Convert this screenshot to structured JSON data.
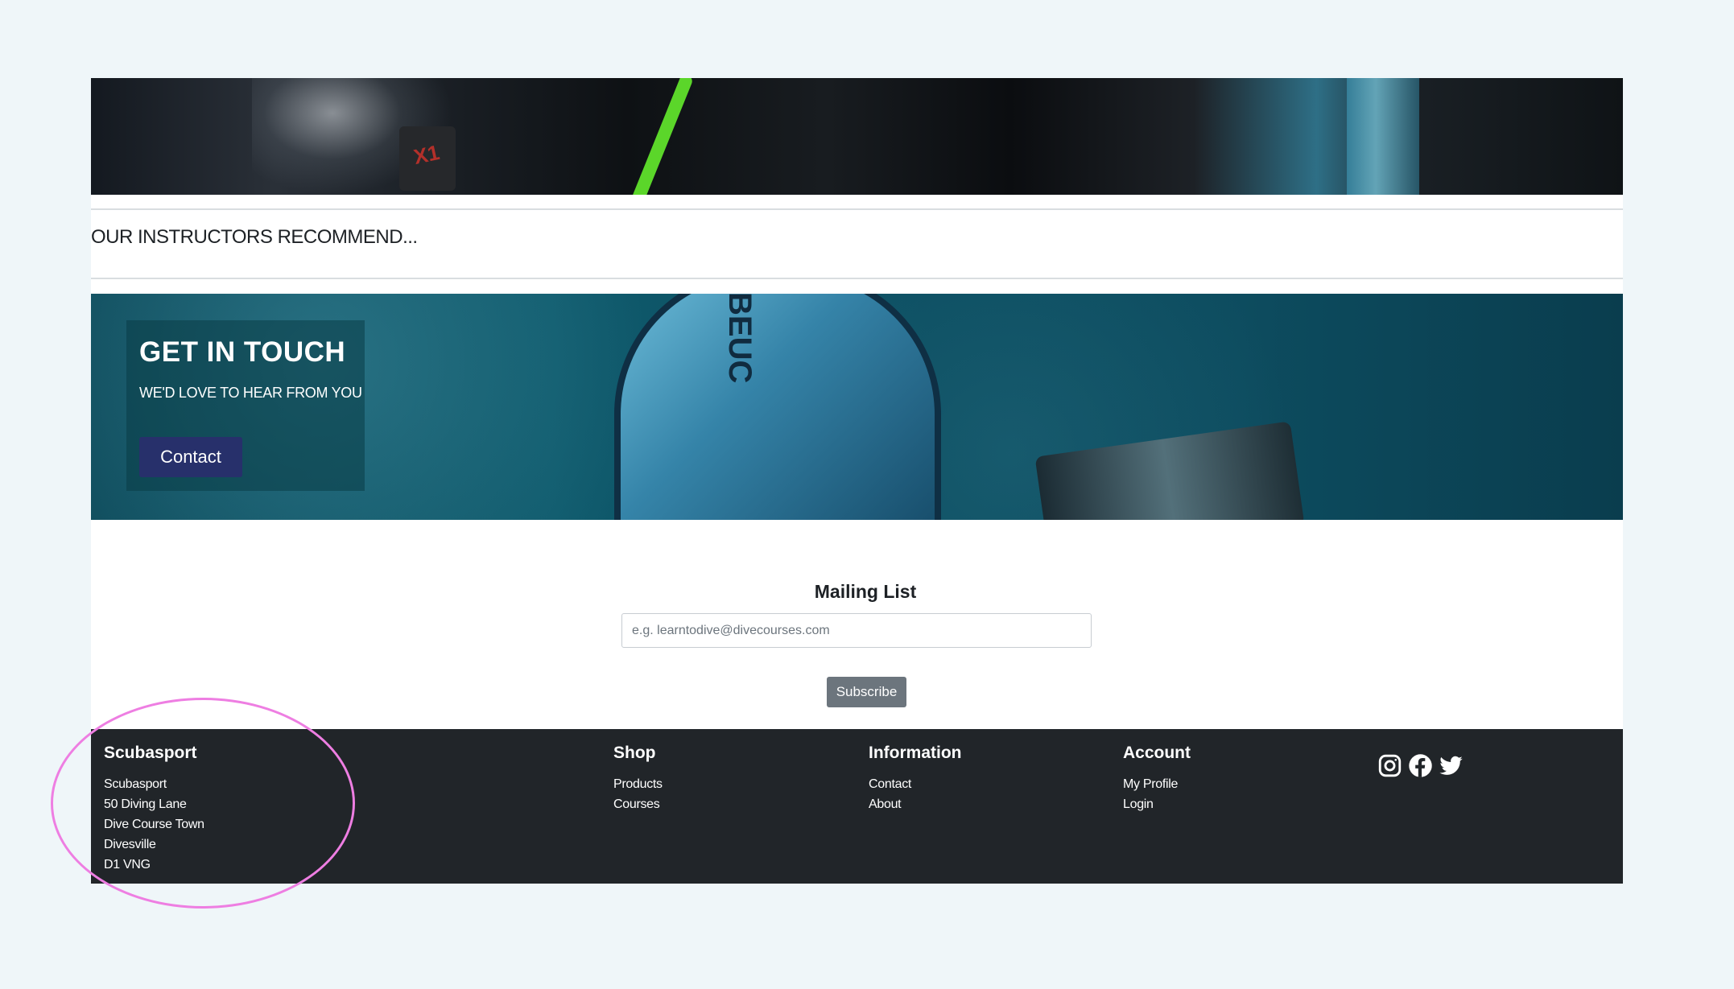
{
  "recommend": {
    "title": "OUR INSTRUCTORS RECOMMEND..."
  },
  "banner": {
    "heading": "GET IN TOUCH",
    "subtext": "WE'D LOVE TO HEAR FROM YOU",
    "contact_label": "Contact"
  },
  "mailing": {
    "title": "Mailing List",
    "placeholder": "e.g. learntodive@divecourses.com",
    "subscribe_label": "Subscribe"
  },
  "footer": {
    "company": {
      "title": "Scubasport",
      "lines": [
        "Scubasport",
        "50 Diving Lane",
        "Dive Course Town",
        "Divesville",
        "D1 VNG"
      ]
    },
    "shop": {
      "title": "Shop",
      "links": [
        "Products",
        "Courses"
      ]
    },
    "information": {
      "title": "Information",
      "links": [
        "Contact",
        "About"
      ]
    },
    "account": {
      "title": "Account",
      "links": [
        "My Profile",
        "Login"
      ]
    },
    "social": [
      "instagram-icon",
      "facebook-icon",
      "twitter-icon"
    ]
  },
  "colors": {
    "page_bg": "#eff6f9",
    "footer_bg": "#212529",
    "contact_button": "#27306b",
    "subscribe_button": "#6c757d",
    "annotation": "#ee7ee2"
  }
}
